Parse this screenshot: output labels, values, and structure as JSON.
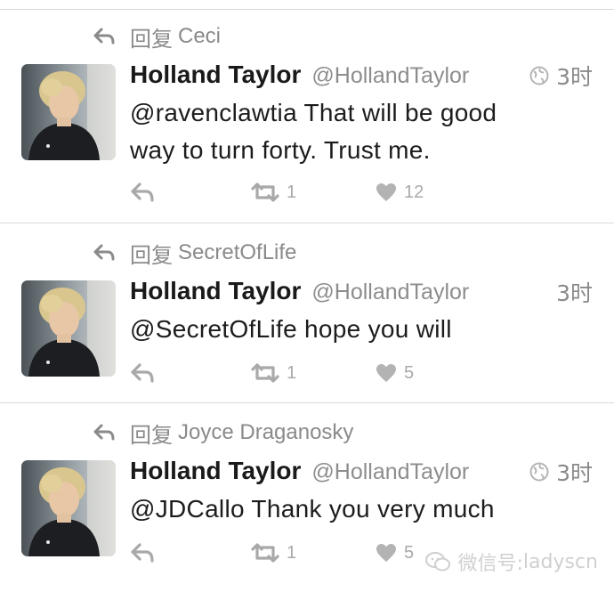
{
  "tweets": [
    {
      "reply_prefix": "回复",
      "reply_to": "Ceci",
      "display_name": "Holland Taylor",
      "handle": "@HollandTaylor",
      "time": "3时",
      "show_globe": true,
      "text_line1": "@ravenclawtia That will be good",
      "text_line2": "way to turn forty.  Trust me.",
      "retweets": "1",
      "likes": "12",
      "avatar_icon": "profile-photo"
    },
    {
      "reply_prefix": "回复",
      "reply_to": "SecretOfLife",
      "display_name": "Holland Taylor",
      "handle": "@HollandTaylor",
      "time": "3时",
      "show_globe": false,
      "text_line1": "@SecretOfLife hope you will",
      "text_line2": "",
      "retweets": "1",
      "likes": "5",
      "avatar_icon": "profile-photo"
    },
    {
      "reply_prefix": "回复",
      "reply_to": "Joyce Draganosky",
      "display_name": "Holland Taylor",
      "handle": "@HollandTaylor",
      "time": "3时",
      "show_globe": true,
      "text_line1": "@JDCallo  Thank you very much",
      "text_line2": "",
      "retweets": "1",
      "likes": "5",
      "avatar_icon": "profile-photo"
    }
  ],
  "icons": {
    "reply": "reply-arrow-icon",
    "retweet": "retweet-icon",
    "like": "heart-icon",
    "globe": "globe-icon",
    "watermark": "wechat-icon"
  },
  "watermark": {
    "label": "微信号:",
    "account": "ladyscn"
  },
  "colors": {
    "muted_text": "#8a8a8a",
    "action_gray": "#a9a9a9",
    "divider": "#d9d9d9"
  }
}
